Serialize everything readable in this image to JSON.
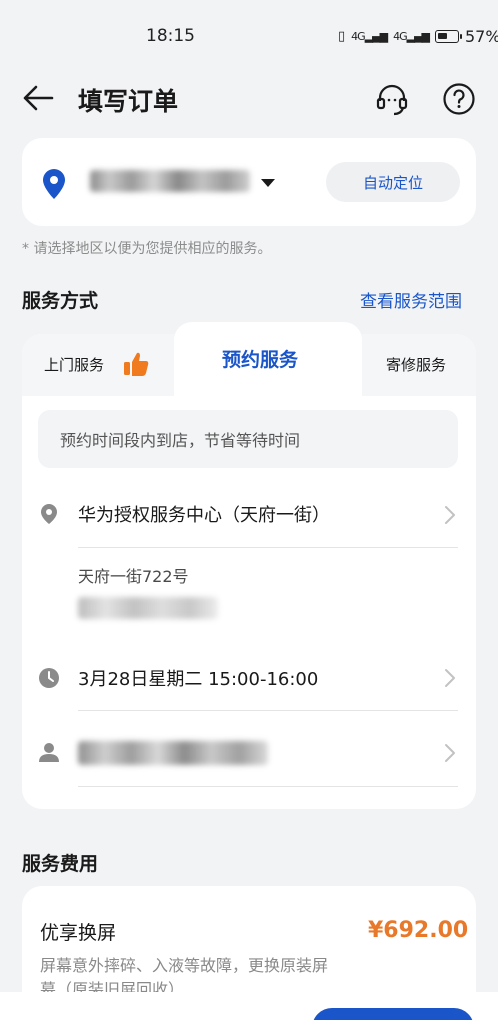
{
  "status_bar": {
    "time": "18:15",
    "network": "4G",
    "battery": "57%"
  },
  "header": {
    "title": "填写订单",
    "icons": [
      "back-arrow-icon",
      "headset-icon",
      "help-icon"
    ]
  },
  "location": {
    "icon": "pin-icon",
    "auto_locate_label": "自动定位"
  },
  "hint": "* 请选择地区以便为您提供相应的服务。",
  "service_method": {
    "title": "服务方式",
    "view_range_label": "查看服务范围",
    "tabs": [
      {
        "label": "上门服务",
        "icon": "thumbs-up-icon"
      },
      {
        "label": "预约服务",
        "active": true
      },
      {
        "label": "寄修服务"
      }
    ],
    "notice": "预约时间段内到店，节省等待时间",
    "store_name": "华为授权服务中心（天府一街）",
    "store_address": "天府一街722号",
    "appointment_time": "3月28日星期二 15:00-16:00"
  },
  "fee": {
    "title": "服务费用",
    "item_name": "优享换屏",
    "price": "¥692.00",
    "description": "屏幕意外摔碎、入液等故障，更换原装屏幕（原装旧屏回收）"
  },
  "colors": {
    "accent": "#1a56c9",
    "price": "#e8782a",
    "background": "#f1f3f5"
  }
}
